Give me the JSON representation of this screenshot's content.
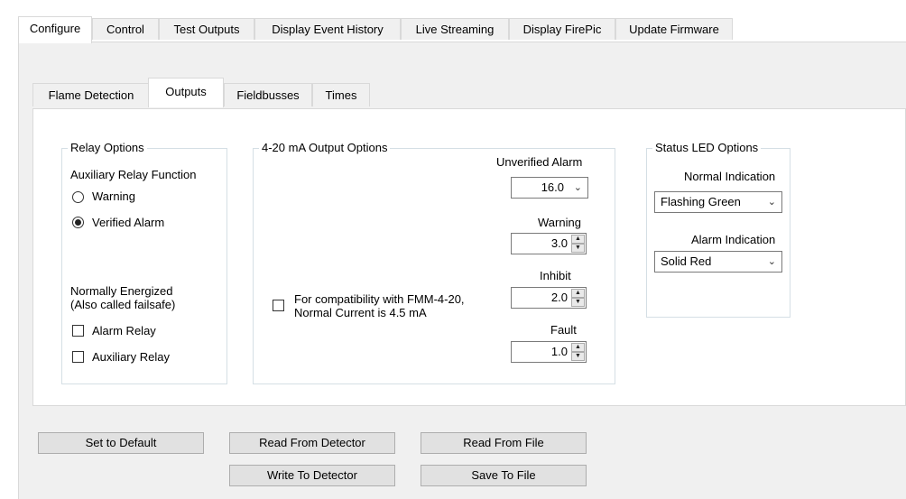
{
  "outer_tabs": [
    {
      "label": "Configure",
      "active": true
    },
    {
      "label": "Control"
    },
    {
      "label": "Test Outputs"
    },
    {
      "label": "Display Event History"
    },
    {
      "label": "Live Streaming"
    },
    {
      "label": "Display FirePic"
    },
    {
      "label": "Update Firmware"
    }
  ],
  "inner_tabs": [
    {
      "label": "Flame Detection"
    },
    {
      "label": "Outputs",
      "active": true
    },
    {
      "label": "Fieldbusses"
    },
    {
      "label": "Times"
    }
  ],
  "relay_options": {
    "title": "Relay Options",
    "aux_function_label": "Auxiliary Relay Function",
    "radio_warning": "Warning",
    "radio_verified": "Verified Alarm",
    "selected": "Verified Alarm",
    "normally_energized_line1": "Normally Energized",
    "normally_energized_line2": "(Also called failsafe)",
    "check_alarm": "Alarm Relay",
    "check_aux": "Auxiliary Relay"
  },
  "output_options": {
    "title": "4-20 mA Output Options",
    "compat_line1": "For compatibility with FMM-4-20,",
    "compat_line2": "Normal Current is 4.5 mA",
    "unverified_label": "Unverified Alarm",
    "unverified_value": "16.0",
    "warning_label": "Warning",
    "warning_value": "3.0",
    "inhibit_label": "Inhibit",
    "inhibit_value": "2.0",
    "fault_label": "Fault",
    "fault_value": "1.0"
  },
  "status_led": {
    "title": "Status LED Options",
    "normal_label": "Normal Indication",
    "normal_value": "Flashing Green",
    "alarm_label": "Alarm Indication",
    "alarm_value": "Solid Red"
  },
  "buttons": {
    "set_default": "Set to Default",
    "read_detector": "Read From Detector",
    "read_file": "Read From File",
    "write_detector": "Write To Detector",
    "save_file": "Save To File"
  },
  "colors": {
    "panel_bg": "#f0f0f0",
    "content_bg": "#ffffff",
    "border": "#d9d9d9",
    "group_border": "#d5dfe5",
    "button_bg": "#e1e1e1"
  }
}
